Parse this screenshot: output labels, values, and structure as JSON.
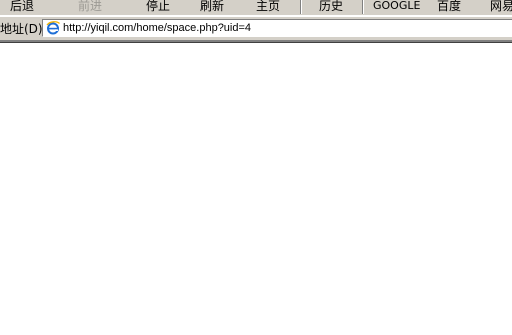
{
  "toolbar": {
    "back_label": "后退",
    "forward_label": "前进",
    "stop_label": "停止",
    "refresh_label": "刷新",
    "home_label": "主页",
    "history_label": "历史",
    "google_label": "GOOGLE",
    "baidu_label": "百度",
    "netease_label": "网易"
  },
  "address_bar": {
    "label": "地址(D)",
    "url": "http://yiqil.com/home/space.php?uid=4"
  },
  "colors": {
    "chrome": "#d4d0c8",
    "disabled_text": "#9c9a94",
    "page_background": "#ffffff"
  }
}
